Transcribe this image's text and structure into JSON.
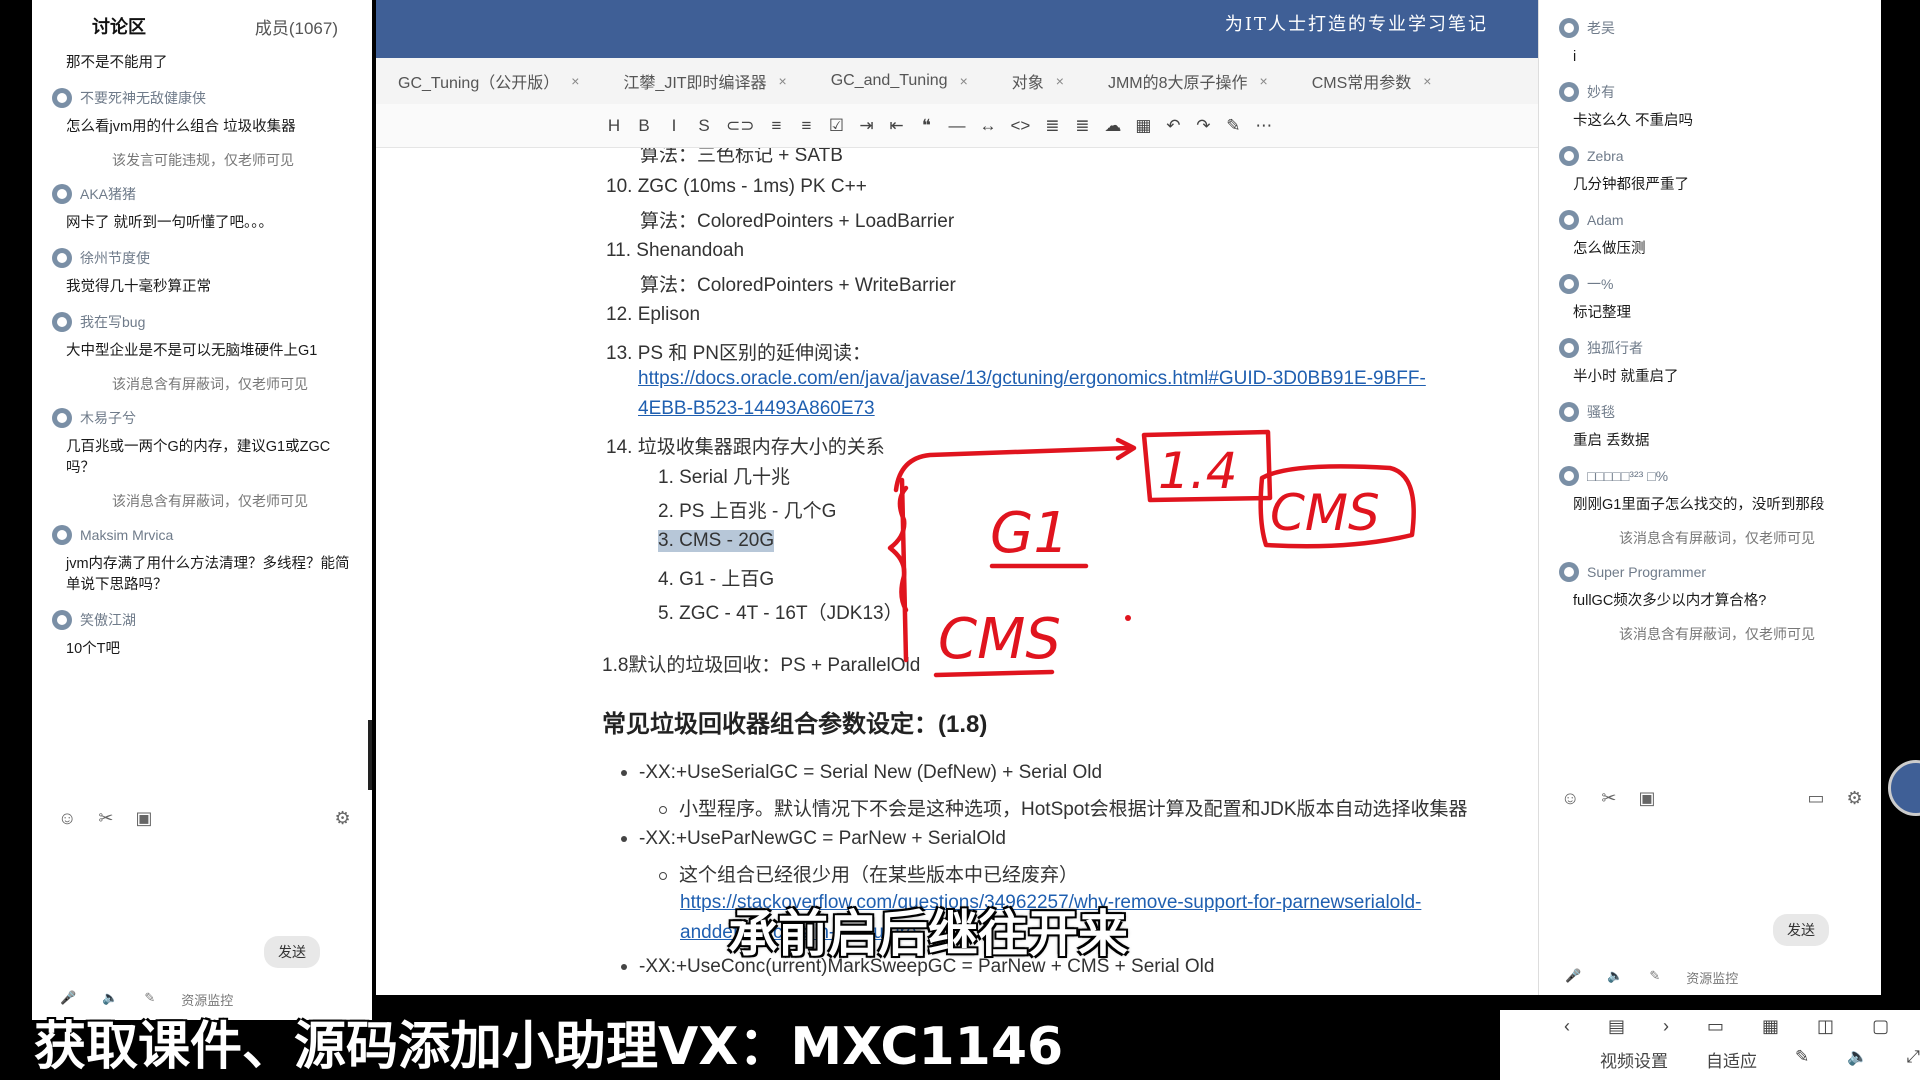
{
  "left_chat": {
    "title": "讨论区",
    "members": "成员(1067)",
    "messages": [
      {
        "user": "",
        "text": "那不是不能用了"
      },
      {
        "user": "不要死神无敌健康侠",
        "text": "怎么看jvm用的什么组合 垃圾收集器"
      },
      {
        "hidden": "该发言可能违规，仅老师可见"
      },
      {
        "user": "AKA猪猪",
        "text": "网卡了 就听到一句听懂了吧。。。"
      },
      {
        "user": "徐州节度使",
        "text": "我觉得几十毫秒算正常"
      },
      {
        "user": "我在写bug",
        "text": "大中型企业是不是可以无脑堆硬件上G1"
      },
      {
        "hidden": "该消息含有屏蔽词，仅老师可见"
      },
      {
        "user": "木易子兮",
        "text": "几百兆或一两个G的内存，建议G1或ZGC吗？"
      },
      {
        "hidden": "该消息含有屏蔽词，仅老师可见"
      },
      {
        "user": "Maksim Mrvica",
        "text": "jvm内存满了用什么方法清理？多线程？能简单说下思路吗？"
      },
      {
        "user": "笑傲江湖",
        "text": "10个T吧"
      }
    ],
    "send_label": "发送",
    "footer_label": "资源监控"
  },
  "banner_text": "为IT人士打造的专业学习笔记",
  "tabs": [
    {
      "label": "GC_Tuning（公开版）"
    },
    {
      "label": "江攀_JIT即时编译器"
    },
    {
      "label": "GC_and_Tuning"
    },
    {
      "label": "对象"
    },
    {
      "label": "JMM的8大原子操作"
    },
    {
      "label": "CMS常用参数"
    }
  ],
  "toolbar_icons": [
    "H",
    "B",
    "I",
    "S",
    "⊂⊃",
    "≡",
    "≡",
    "☑",
    "⇥",
    "⇤",
    "❝",
    "—",
    "↔",
    "<>",
    "≣",
    "≣",
    "☁",
    "▦",
    "↶",
    "↷",
    "✎",
    "⋯"
  ],
  "note": {
    "l0": "算法：三色标记 + SATB",
    "l1": "10. ZGC (10ms - 1ms) PK C++",
    "l2": "算法：ColoredPointers + LoadBarrier",
    "l3": "11. Shenandoah",
    "l4": "算法：ColoredPointers + WriteBarrier",
    "l5": "12. Eplison",
    "l6": "13. PS 和 PN区别的延伸阅读：",
    "l7": "https://docs.oracle.com/en/java/javase/13/gctuning/ergonomics.html#GUID-3D0BB91E-9BFF-",
    "l8": "4EBB-B523-14493A860E73",
    "l9": "14. 垃圾收集器跟内存大小的关系",
    "l10": "1. Serial 几十兆",
    "l11": "2. PS 上百兆 - 几个G",
    "l12": "3. CMS - 20G",
    "l13": "4. G1 - 上百G",
    "l14": "5. ZGC - 4T - 16T（JDK13）",
    "l15": "1.8默认的垃圾回收：PS + ParallelOld",
    "heading": "常见垃圾回收器组合参数设定：(1.8)",
    "b1": "-XX:+UseSerialGC = Serial New (DefNew) + Serial Old",
    "b1s": "小型程序。默认情况下不会是这种选项，HotSpot会根据计算及配置和JDK版本自动选择收集器",
    "b2": "-XX:+UseParNewGC = ParNew + SerialOld",
    "b2s": "这个组合已经很少用（在某些版本中已经废弃）",
    "b2link": "https://stackoverflow.com/questions/34962257/why-remove-support-for-parnewserialold-",
    "b2link2": "anddefnewcms-in-the-future",
    "b3": "-XX:+UseConc(urrent)MarkSweepGC = ParNew + CMS + Serial Old"
  },
  "annotations": {
    "a1": "1.4",
    "a2": "CMS",
    "a3": "G1",
    "a4": "CMS"
  },
  "right_chat": {
    "messages": [
      {
        "user": "老吴",
        "text": "i"
      },
      {
        "user": "妙有",
        "text": "卡这么久  不重启吗"
      },
      {
        "user": "Zebra",
        "text": "几分钟都很严重了"
      },
      {
        "user": "Adam",
        "text": "怎么做压测"
      },
      {
        "user": "一%",
        "text": "标记整理"
      },
      {
        "user": "独孤行者",
        "text": "半小时  就重启了"
      },
      {
        "user": "骚毯",
        "text": "重启 丢数据"
      },
      {
        "user": "□□□□□³²³ □%",
        "text": "刚刚G1里面子怎么找交的，没听到那段"
      },
      {
        "hidden": "该消息含有屏蔽词，仅老师可见"
      },
      {
        "user": "Super Programmer",
        "text": "fullGC频次多少以内才算合格?"
      },
      {
        "hidden": "该消息含有屏蔽词，仅老师可见"
      }
    ],
    "send_label": "发送",
    "footer_label": "资源监控"
  },
  "bottom_bar": {
    "video_settings": "视频设置",
    "auto_fit": "自适应"
  },
  "subtitle": "承前启后继往开来",
  "caption": "获取课件、源码添加小助理VX：MXC1146",
  "colors": {
    "accent": "#3f5f96",
    "annotation_red": "#e0141e"
  }
}
